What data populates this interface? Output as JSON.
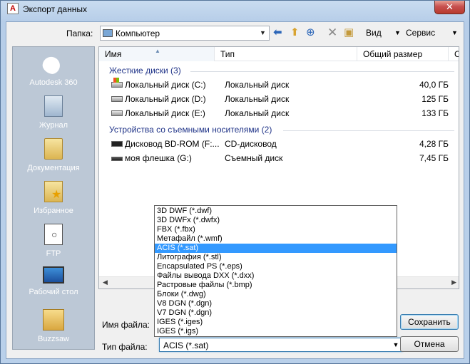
{
  "window": {
    "title": "Экспорт данных",
    "app_icon": "autocad-icon",
    "close_glyph": "✕"
  },
  "toolbar": {
    "folder_label": "Папка:",
    "folder_value": "Компьютер",
    "view_label": "Вид",
    "tools_label": "Сервис",
    "icons": [
      "back-arrow-icon",
      "up-folder-icon",
      "search-web-icon",
      "delete-icon",
      "new-folder-icon"
    ]
  },
  "places": [
    {
      "label": "Autodesk 360",
      "icon": "cloud-icon"
    },
    {
      "label": "Журнал",
      "icon": "history-icon"
    },
    {
      "label": "Документация",
      "icon": "documents-folder-icon"
    },
    {
      "label": "Избранное",
      "icon": "favorites-icon"
    },
    {
      "label": "FTP",
      "icon": "ftp-icon"
    },
    {
      "label": "Рабочий стол",
      "icon": "desktop-icon"
    },
    {
      "label": "Buzzsaw",
      "icon": "buzzsaw-icon"
    }
  ],
  "filelist": {
    "columns": [
      "Имя",
      "Тип",
      "Общий размер",
      "Св"
    ],
    "groups": [
      {
        "title": "Жесткие диски (3)",
        "rows": [
          {
            "name": "Локальный диск (C:)",
            "type": "Локальный диск",
            "size": "40,0 ГБ"
          },
          {
            "name": "Локальный диск (D:)",
            "type": "Локальный диск",
            "size": "125 ГБ"
          },
          {
            "name": "Локальный диск (E:)",
            "type": "Локальный диск",
            "size": "133 ГБ"
          }
        ]
      },
      {
        "title": "Устройства со съемными носителями (2)",
        "rows": [
          {
            "name": "Дисковод BD-ROM (F:...",
            "type": "CD-дисковод",
            "size": "4,28 ГБ"
          },
          {
            "name": "моя флешка (G:)",
            "type": "Съемный диск",
            "size": "7,45 ГБ"
          }
        ]
      }
    ]
  },
  "form": {
    "filename_label": "Имя файла:",
    "filetype_label": "Тип файла:",
    "filetype_value": "ACIS (*.sat)",
    "save_label": "Сохранить",
    "cancel_label": "Отмена"
  },
  "dropdown": {
    "selected_index": 4,
    "options": [
      "3D DWF (*.dwf)",
      "3D DWFx (*.dwfx)",
      "FBX (*.fbx)",
      "Метафайл (*.wmf)",
      "ACIS (*.sat)",
      "Литография (*.stl)",
      "Encapsulated PS (*.eps)",
      "Файлы вывода DXX (*.dxx)",
      "Растровые файлы (*.bmp)",
      "Блоки (*.dwg)",
      "V8 DGN (*.dgn)",
      "V7 DGN (*.dgn)",
      "IGES (*.iges)",
      "IGES (*.igs)"
    ]
  },
  "colors": {
    "selection": "#3399ff",
    "group_header": "#1e3287",
    "places_panel": "#bcc8d6"
  }
}
